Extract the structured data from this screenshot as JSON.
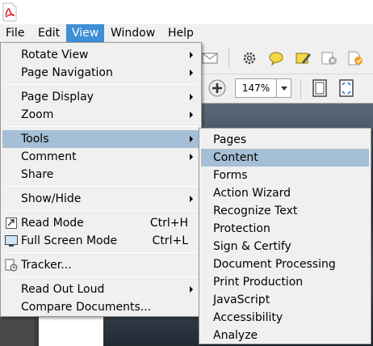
{
  "menubar": {
    "items": [
      {
        "label": "File"
      },
      {
        "label": "Edit"
      },
      {
        "label": "View"
      },
      {
        "label": "Window"
      },
      {
        "label": "Help"
      }
    ]
  },
  "toolbar": {
    "zoom_value": "147%"
  },
  "view_menu": {
    "items": [
      {
        "label": "Rotate View",
        "submenu": true
      },
      {
        "label": "Page Navigation",
        "submenu": true
      },
      {
        "label": "Page Display",
        "submenu": true
      },
      {
        "label": "Zoom",
        "submenu": true
      },
      {
        "label": "Tools",
        "submenu": true,
        "highlighted": true
      },
      {
        "label": "Comment",
        "submenu": true
      },
      {
        "label": "Share"
      },
      {
        "label": "Show/Hide",
        "submenu": true
      },
      {
        "label": "Read Mode",
        "shortcut": "Ctrl+H",
        "icon": "read-mode-icon"
      },
      {
        "label": "Full Screen Mode",
        "shortcut": "Ctrl+L",
        "icon": "full-screen-icon"
      },
      {
        "label": "Tracker...",
        "icon": "tracker-icon"
      },
      {
        "label": "Read Out Loud",
        "submenu": true
      },
      {
        "label": "Compare Documents..."
      }
    ]
  },
  "tools_submenu": {
    "items": [
      {
        "label": "Pages"
      },
      {
        "label": "Content",
        "highlighted": true
      },
      {
        "label": "Forms"
      },
      {
        "label": "Action Wizard"
      },
      {
        "label": "Recognize Text"
      },
      {
        "label": "Protection"
      },
      {
        "label": "Sign & Certify"
      },
      {
        "label": "Document Processing"
      },
      {
        "label": "Print Production"
      },
      {
        "label": "JavaScript"
      },
      {
        "label": "Accessibility"
      },
      {
        "label": "Analyze"
      }
    ]
  }
}
